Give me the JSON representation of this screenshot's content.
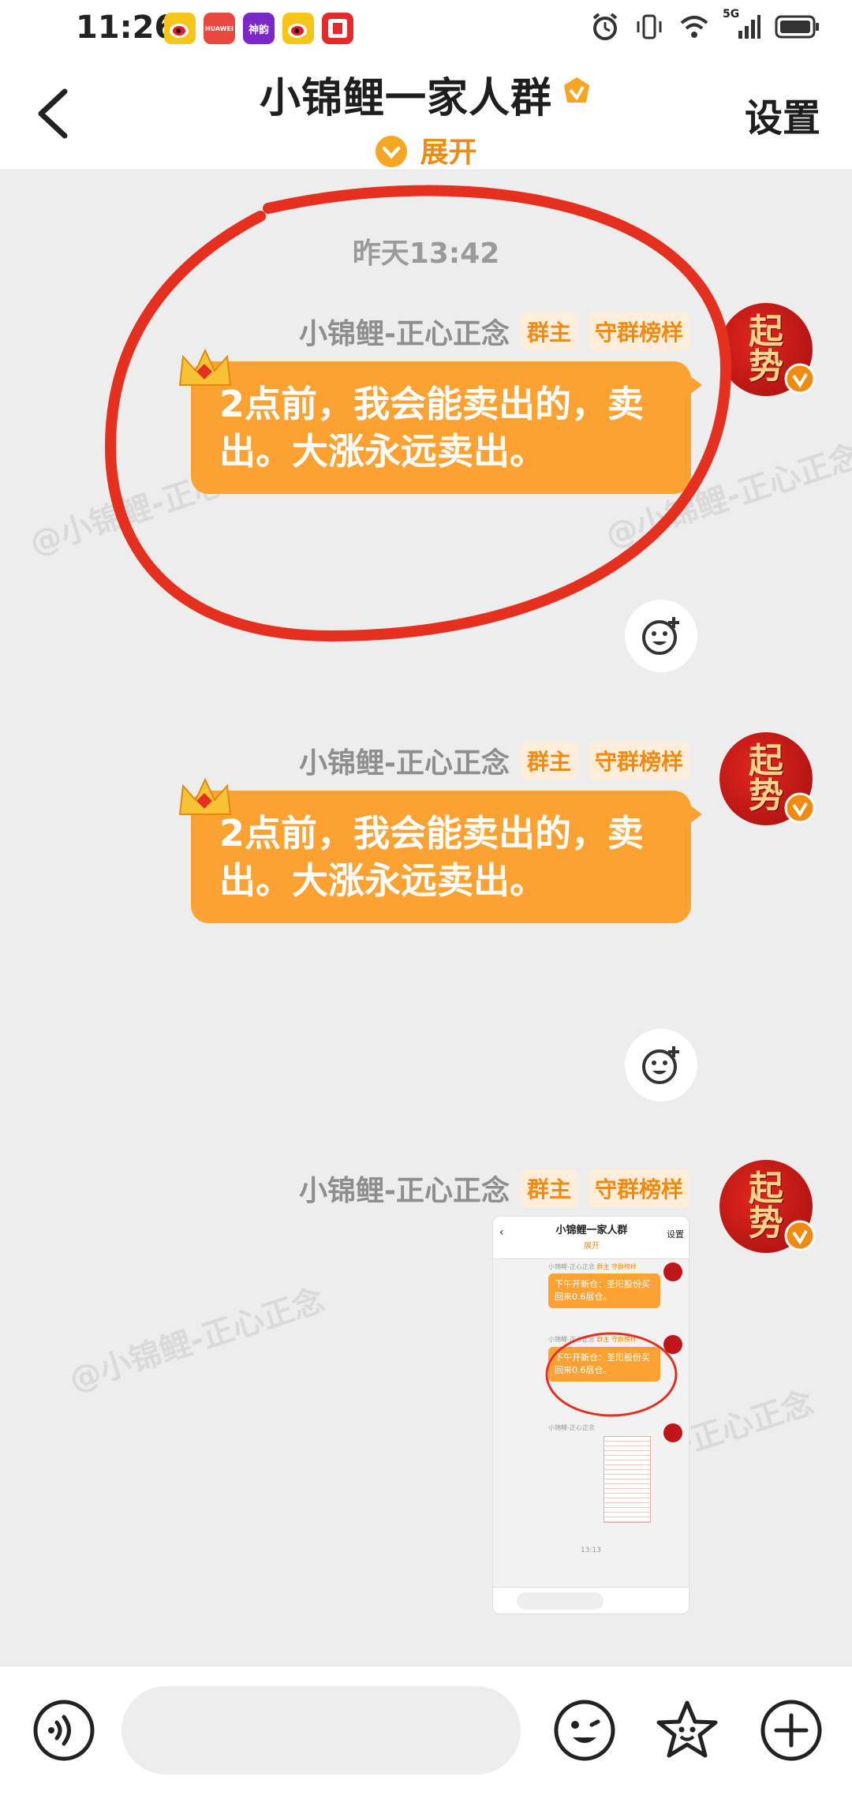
{
  "status_bar": {
    "time": "11:26",
    "app_icons": [
      "weibo-icon",
      "huawei-icon",
      "shenxing-icon",
      "weibo-icon",
      "calendar-icon"
    ],
    "network": "5G"
  },
  "header": {
    "back_icon": "chevron-left-icon",
    "title": "小锦鲤一家人群",
    "expand_label": "展开",
    "settings_label": "设置"
  },
  "chat": {
    "timestamp": "昨天13:42",
    "watermark": "@小锦鲤-正心正念",
    "messages": [
      {
        "sender": "小锦鲤-正心正念",
        "tags": [
          "群主",
          "守群榜样"
        ],
        "text": "2点前，我会能卖出的，卖出。大涨永远卖出。",
        "avatar_text": "起势"
      },
      {
        "sender": "小锦鲤-正心正念",
        "tags": [
          "群主",
          "守群榜样"
        ],
        "text": "2点前，我会能卖出的，卖出。大涨永远卖出。",
        "avatar_text": "起势"
      },
      {
        "sender": "小锦鲤-正心正念",
        "tags": [
          "群主",
          "守群榜样"
        ],
        "type": "image",
        "avatar_text": "起势",
        "image": {
          "title": "小锦鲤一家人群",
          "expand": "展开",
          "settings": "设置",
          "sender": "小锦鲤-正心正念",
          "tag1": "群主",
          "tag2": "守群榜样",
          "msg": "下午开新仓：圣阳股份买回来0.6层仓。",
          "time": "13:13"
        }
      }
    ]
  },
  "bottom_bar": {
    "input_placeholder": "",
    "icons": [
      "voice-icon",
      "emoji-icon",
      "sticker-icon",
      "plus-icon"
    ]
  },
  "colors": {
    "accent": "#f08a10",
    "bubble": "#fba233",
    "annotation": "#e53020",
    "avatar": "#c0161a"
  }
}
